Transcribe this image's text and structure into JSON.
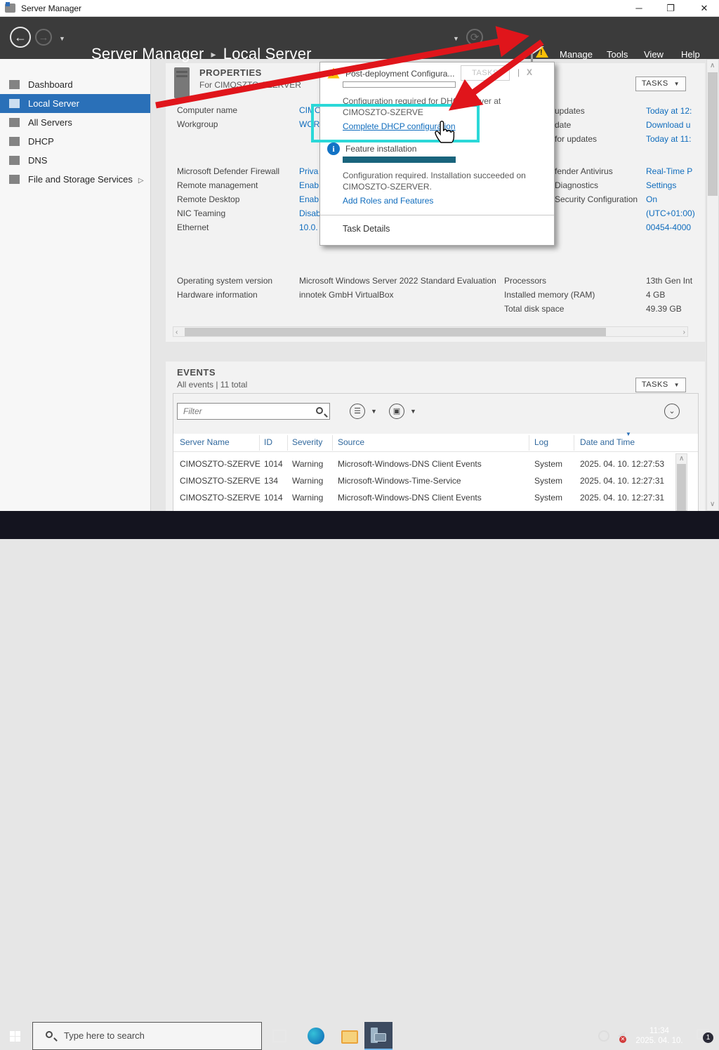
{
  "colors": {
    "accent_blue": "#2a70b8",
    "link_blue": "#0f6cbd",
    "cyan_highlight": "#2bd8d8",
    "arrow_red": "#e0151b",
    "warning_yellow": "#fcc006",
    "info_blue": "#1273c5",
    "progress_teal": "#19647c"
  },
  "titlebar": {
    "title": "Server Manager",
    "minimize": "─",
    "restore": "❐",
    "close": "✕"
  },
  "nav": {
    "breadcrumb_root": "Server Manager",
    "breadcrumb_sep": "▸",
    "breadcrumb_current": "Local Server",
    "menus": [
      "Manage",
      "Tools",
      "View",
      "Help"
    ]
  },
  "sidebar": {
    "items": [
      {
        "label": "Dashboard",
        "icon": "dashboard-icon",
        "selected": false,
        "expand": ""
      },
      {
        "label": "Local Server",
        "icon": "local-server-icon",
        "selected": true,
        "expand": ""
      },
      {
        "label": "All Servers",
        "icon": "all-servers-icon",
        "selected": false,
        "expand": ""
      },
      {
        "label": "DHCP",
        "icon": "dhcp-icon",
        "selected": false,
        "expand": ""
      },
      {
        "label": "DNS",
        "icon": "dns-icon",
        "selected": false,
        "expand": ""
      },
      {
        "label": "File and Storage Services",
        "icon": "file-storage-icon",
        "selected": false,
        "expand": "▷"
      }
    ]
  },
  "properties": {
    "title": "PROPERTIES",
    "subtitle": "For CIMOSZTO-SZERVER",
    "tasks_label": "TASKS",
    "left_rows": [
      {
        "label": "Computer name",
        "value": "CIMO"
      },
      {
        "label": "Workgroup",
        "value": "WOR"
      },
      {
        "label": "Microsoft Defender Firewall",
        "value": "Priva"
      },
      {
        "label": "Remote management",
        "value": "Enab"
      },
      {
        "label": "Remote Desktop",
        "value": "Enab"
      },
      {
        "label": "NIC Teaming",
        "value": "Disab"
      },
      {
        "label": "Ethernet",
        "value": "10.0."
      },
      {
        "label": "Operating system version",
        "value": "Microsoft Windows Server 2022 Standard Evaluation"
      },
      {
        "label": "Hardware information",
        "value": "innotek GmbH VirtualBox"
      }
    ],
    "right_rows": [
      {
        "label": "updates",
        "value": "Today at 12:"
      },
      {
        "label": "date",
        "value": "Download u"
      },
      {
        "label": "for updates",
        "value": "Today at 11:"
      },
      {
        "label": "fender Antivirus",
        "value": "Real-Time P"
      },
      {
        "label": "Diagnostics",
        "value": "Settings"
      },
      {
        "label": "Security Configuration",
        "value": "On"
      },
      {
        "label": "",
        "value": "(UTC+01:00)"
      },
      {
        "label": "",
        "value": "00454-4000"
      }
    ],
    "bottom_right_rows": [
      {
        "label": "Processors",
        "value": "13th Gen Int"
      },
      {
        "label": "Installed memory (RAM)",
        "value": "4 GB"
      },
      {
        "label": "Total disk space",
        "value": "49.39 GB"
      }
    ]
  },
  "events": {
    "title": "EVENTS",
    "subtitle": "All events | 11 total",
    "tasks_label": "TASKS",
    "filter_placeholder": "Filter",
    "headers": [
      "Server Name",
      "ID",
      "Severity",
      "Source",
      "Log",
      "Date and Time"
    ],
    "rows": [
      [
        "CIMOSZTO-SZERVE",
        "1014",
        "Warning",
        "Microsoft-Windows-DNS Client Events",
        "System",
        "2025. 04. 10. 12:27:53"
      ],
      [
        "CIMOSZTO-SZERVE",
        "134",
        "Warning",
        "Microsoft-Windows-Time-Service",
        "System",
        "2025. 04. 10. 12:27:31"
      ],
      [
        "CIMOSZTO-SZERVE",
        "1014",
        "Warning",
        "Microsoft-Windows-DNS Client Events",
        "System",
        "2025. 04. 10. 12:27:31"
      ]
    ]
  },
  "popup": {
    "title": "Post-deployment Configura...",
    "tasks_label": "TASKS",
    "close": "X",
    "separator": "|",
    "msg1_line1": "Configuration required for DHCP Server at",
    "msg1_line2": "CIMOSZTO-SZERVE",
    "link1": "Complete DHCP configuration",
    "section2_title": "Feature installation",
    "msg2_line1": "Configuration required. Installation succeeded on",
    "msg2_line2": "CIMOSZTO-SZERVER.",
    "link2": "Add Roles and Features",
    "task_details": "Task Details"
  },
  "taskbar": {
    "search_placeholder": "Type here to search",
    "time": "11:34",
    "date": "2025. 04. 10.",
    "notification_badge": "1"
  }
}
